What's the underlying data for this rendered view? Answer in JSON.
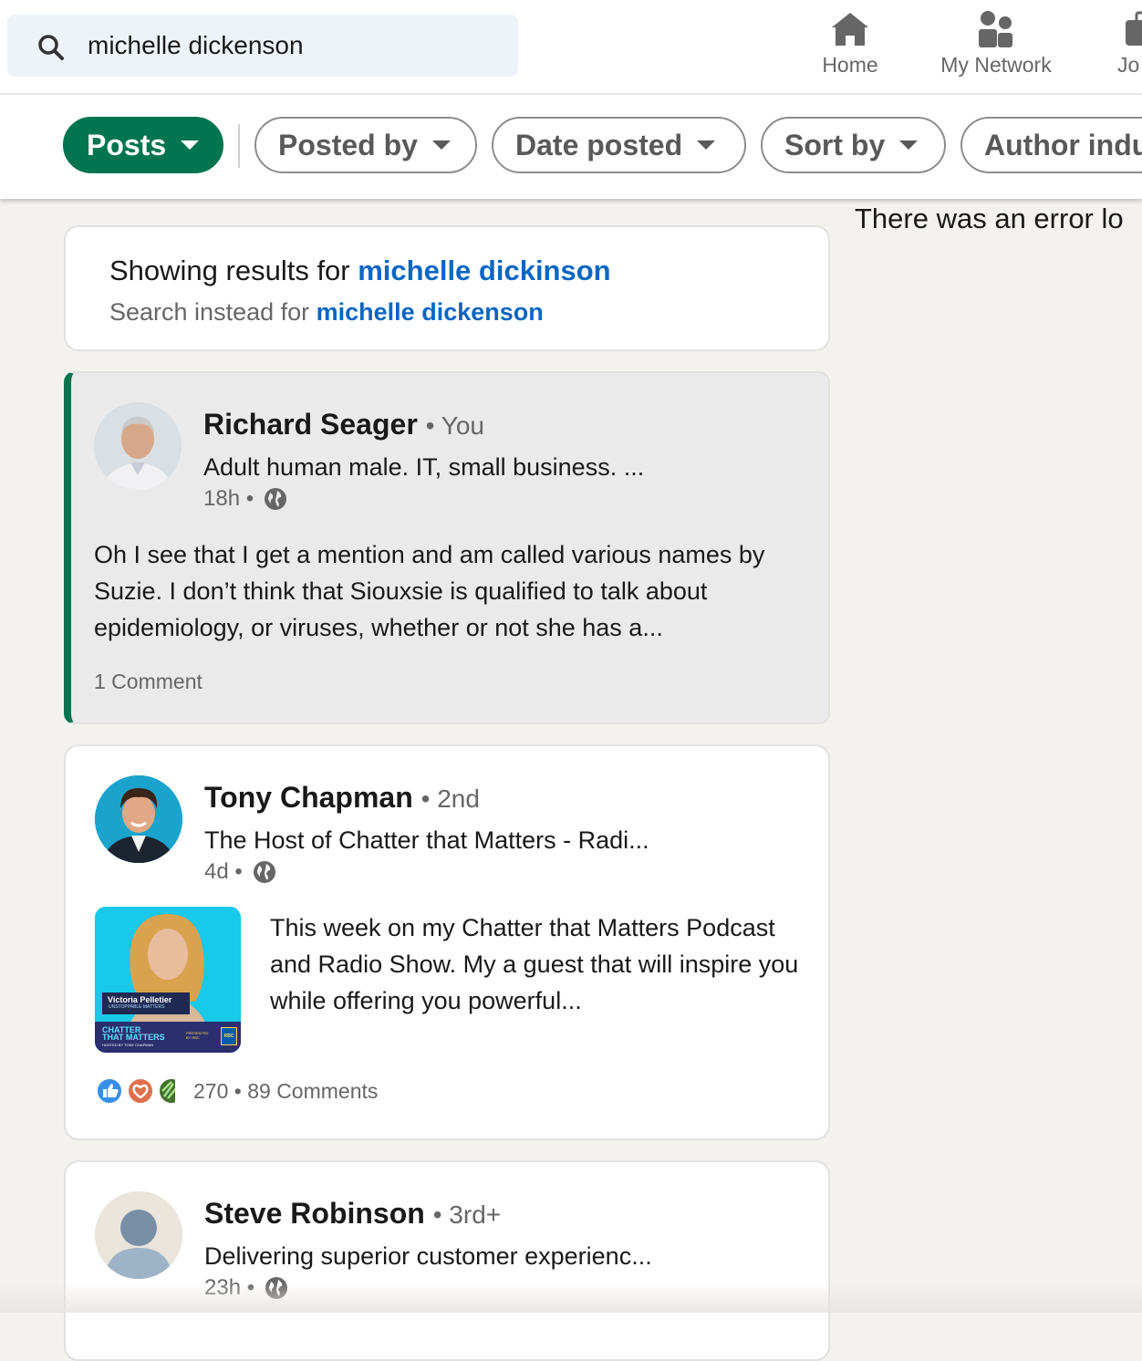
{
  "search": {
    "value": "michelle dickenson"
  },
  "nav": {
    "home": "Home",
    "network": "My Network",
    "jobs": "Jo"
  },
  "filters": {
    "posts": "Posts",
    "posted_by": "Posted by",
    "date_posted": "Date posted",
    "sort_by": "Sort by",
    "author_industry": "Author indu"
  },
  "rail": {
    "error_text": "There was an error lo"
  },
  "correction": {
    "showing_prefix": "Showing results for ",
    "corrected_query": "michelle dickinson",
    "instead_prefix": "Search instead for ",
    "original_query": "michelle dickenson"
  },
  "posts": [
    {
      "author": "Richard Seager",
      "degree": "You",
      "headline": "Adult human male. IT, small business. ...",
      "time": "18h",
      "text": "Oh I see that I get a mention and am called various names by Suzie. I don’t think that Siouxsie is qualified to talk about epidemiology, or viruses, whether or not she has a...",
      "comments": "1 Comment"
    },
    {
      "author": "Tony Chapman",
      "degree": "2nd",
      "headline": "The Host of Chatter that Matters - Radi...",
      "time": "4d",
      "text": "This week on my Chatter that Matters Podcast and Radio Show. My a guest that will inspire you while offering you powerful...",
      "thumbnail": {
        "name": "Victoria Pelletier",
        "tagline": "UNSTOPPABLE MATTERS",
        "show_line1": "CHATTER",
        "show_line2": "THAT MATTERS",
        "host_line": "HOSTED BY TONY CHAPMAN",
        "presented": "PRESENTED",
        "presented_by": "BY RBC",
        "sponsor": "RBC"
      },
      "reactions": "270",
      "comments": "89 Comments"
    },
    {
      "author": "Steve Robinson",
      "degree": "3rd+",
      "headline": "Delivering superior customer experienc...",
      "time": "23h"
    }
  ],
  "colors": {
    "brand_green": "#01754f",
    "link_blue": "#0a66c2",
    "page_bg": "#f4f2ee"
  }
}
